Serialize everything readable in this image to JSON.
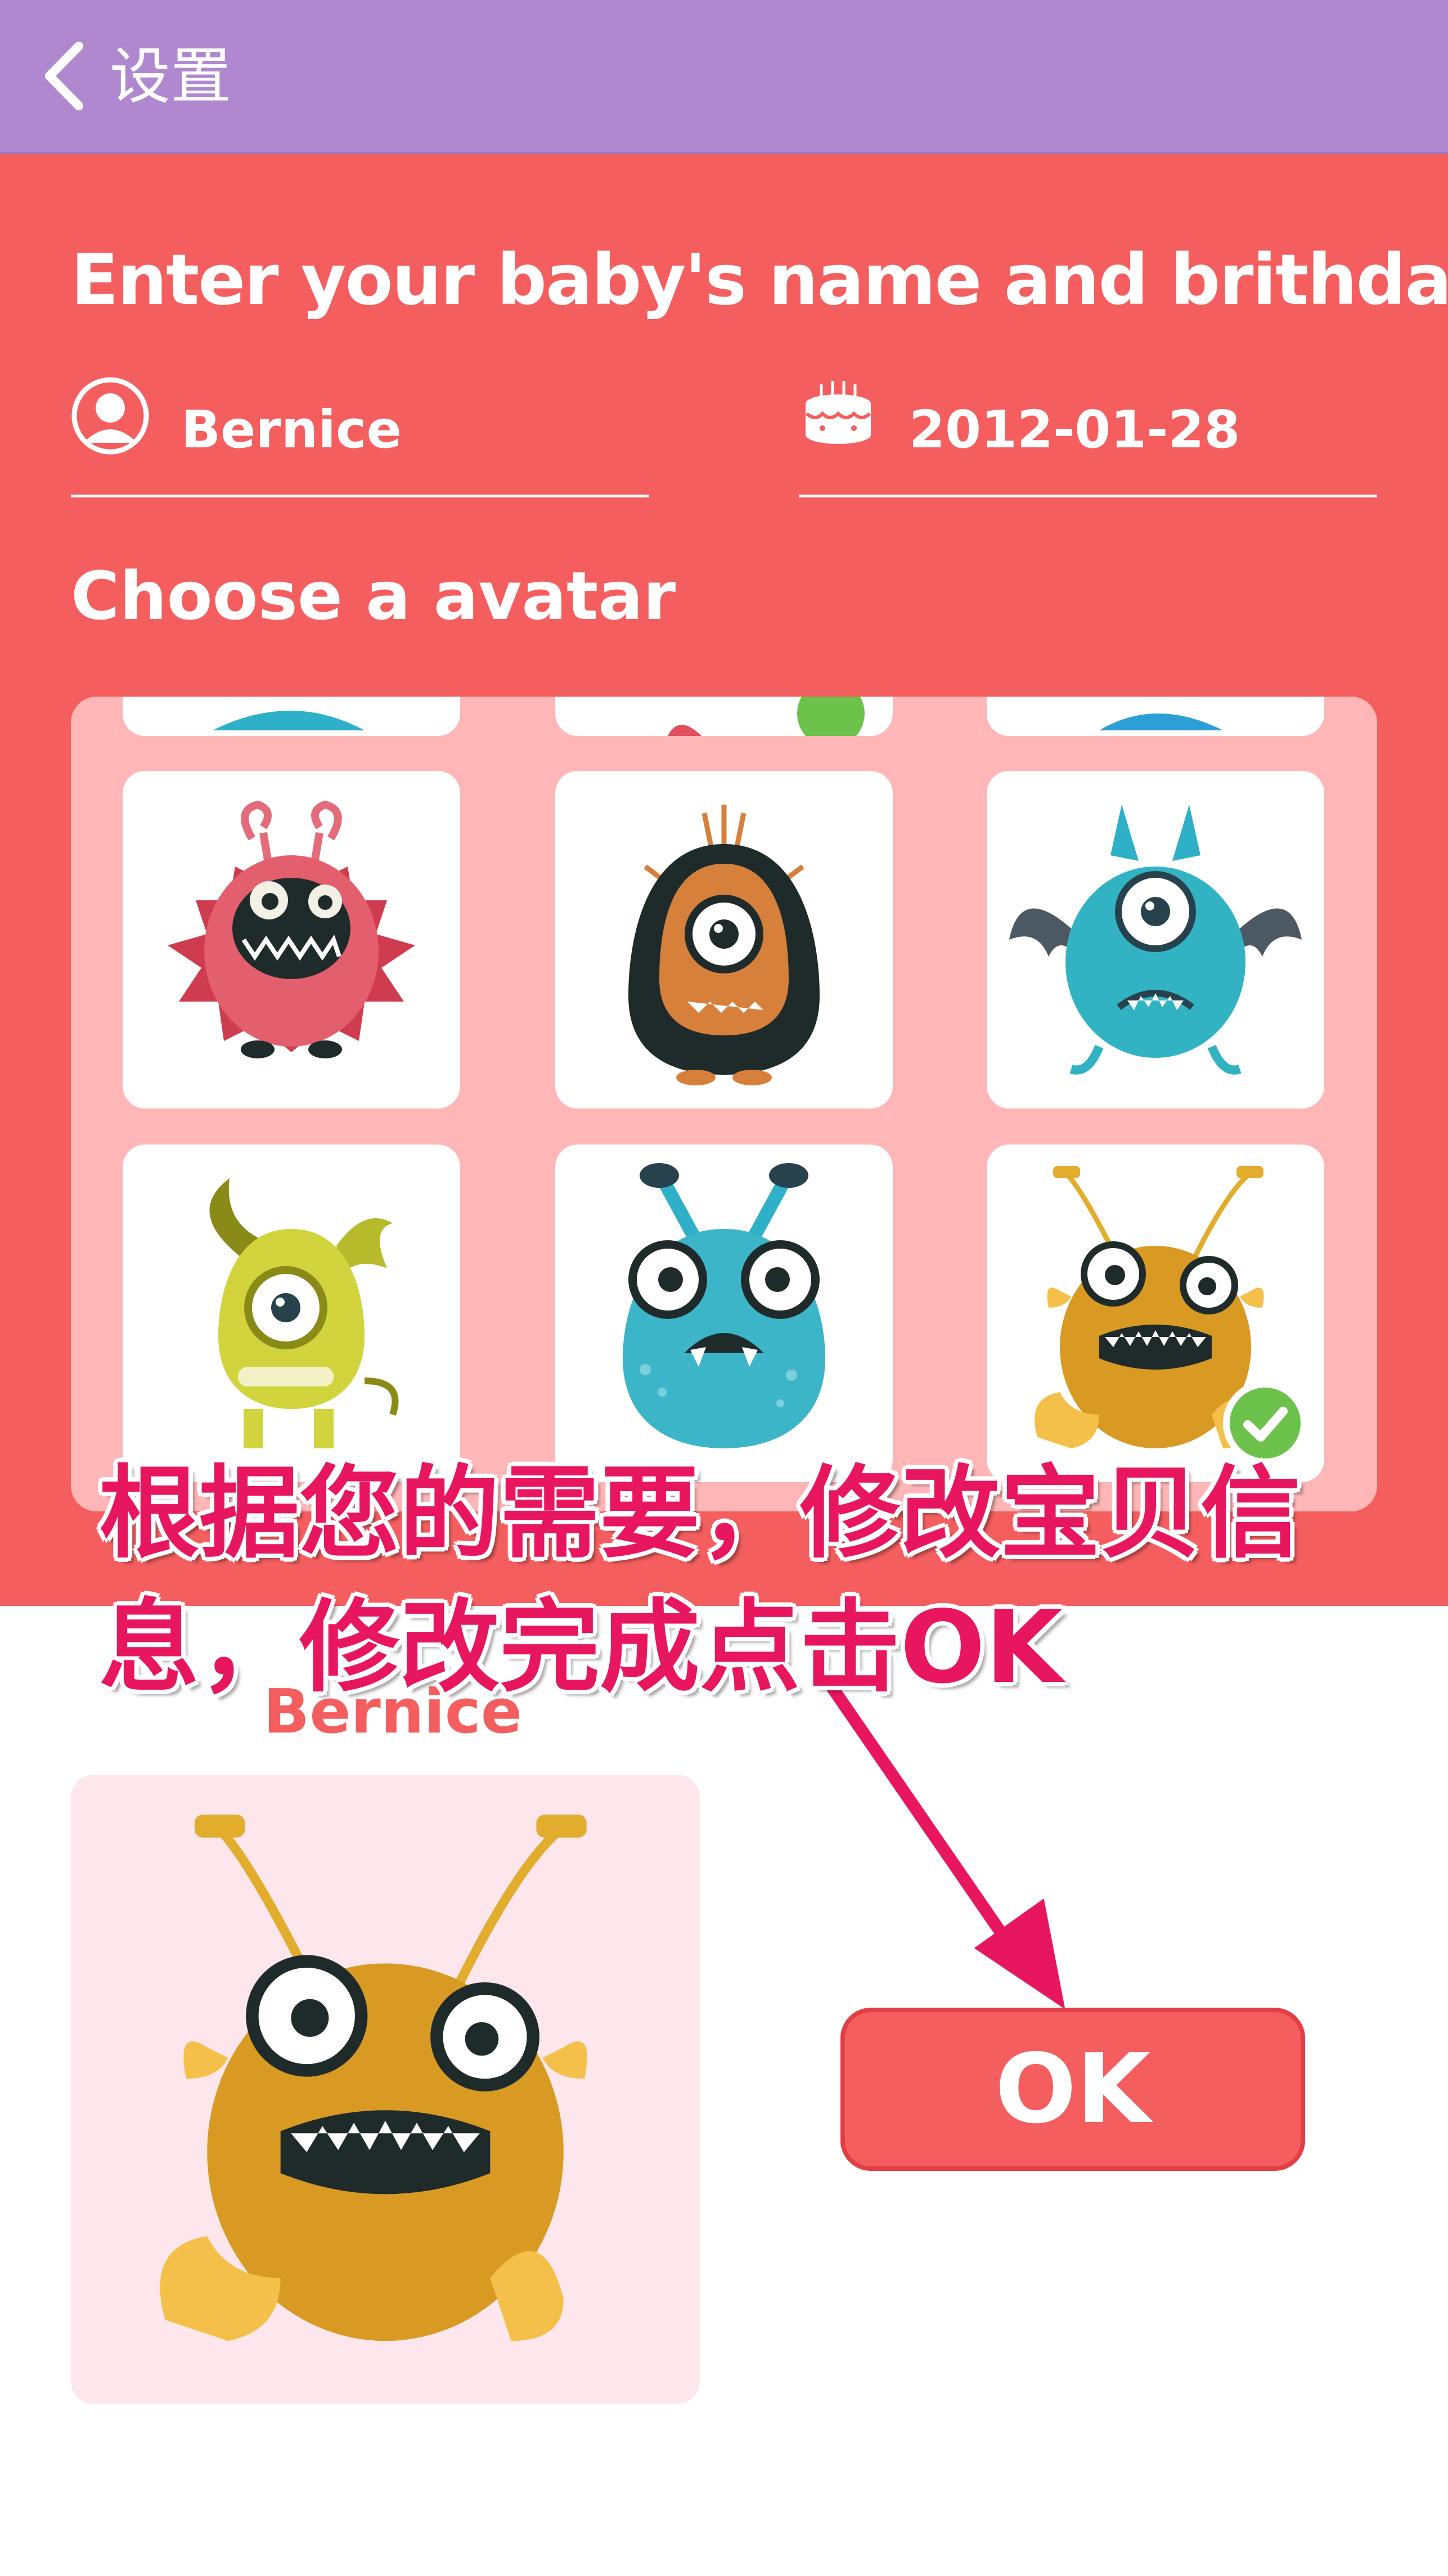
{
  "header": {
    "back_icon": "chevron-left-icon",
    "title": "设置",
    "color": "#b088cf"
  },
  "form": {
    "heading": "Enter your baby's name and brithday",
    "name_icon": "person-icon",
    "name_value": "Bernice",
    "birthday_icon": "birthday-cake-icon",
    "birthday_value": "2012-01-28",
    "avatar_heading": "Choose a avatar",
    "panel_color": "#f55e5e"
  },
  "avatar_grid": {
    "tiles": [
      {
        "name": "red-spiky-monster"
      },
      {
        "name": "orange-one-eyed-monster"
      },
      {
        "name": "teal-winged-monster"
      },
      {
        "name": "yellow-green-dog-monster"
      },
      {
        "name": "blue-antenna-monster"
      },
      {
        "name": "orange-bug-monster",
        "selected": true
      }
    ]
  },
  "preview": {
    "name": "Bernice",
    "avatar": "orange-bug-monster"
  },
  "ok_button": {
    "label": "OK"
  },
  "annotation": {
    "line1": "根据您的需要，修改宝贝信",
    "line2": "息，修改完成点击OK",
    "color": "#e8155f"
  }
}
